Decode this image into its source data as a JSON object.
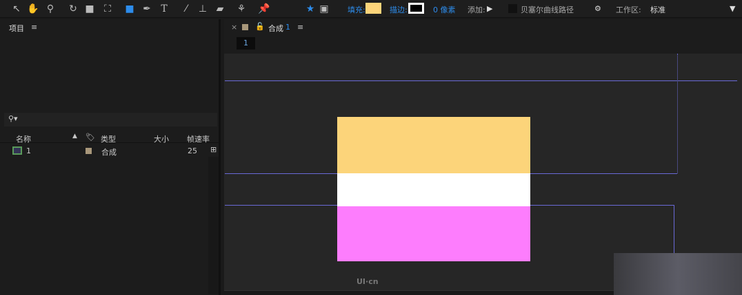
{
  "toolbar": {
    "tools": [
      "selection-tool",
      "hand-tool",
      "zoom-tool",
      "rotate-tool",
      "camera-tool",
      "pan-behind-tool",
      "rectangle-tool",
      "pen-tool",
      "text-tool",
      "brush-tool",
      "clone-stamp-tool",
      "eraser-tool",
      "roto-brush-tool",
      "puppet-pin-tool"
    ],
    "fill_label": "填充:",
    "fill_color": "#fcd47a",
    "stroke_label": "描边:",
    "stroke_width": "0 像素",
    "add_label": "添加:",
    "bezier_label": "贝塞尔曲线路径",
    "workspace_label": "工作区:",
    "workspace_value": "标准"
  },
  "project": {
    "title": "项目",
    "columns": [
      "名称",
      "类型",
      "大小",
      "帧速率"
    ],
    "rows": [
      {
        "name": "1",
        "type": "合成",
        "size": "",
        "fps": "25"
      }
    ]
  },
  "comp": {
    "close": "×",
    "title": "合成",
    "title_num": "1",
    "tab": "1",
    "layers": [
      {
        "color": "#fcd47a"
      },
      {
        "color": "#ffffff"
      },
      {
        "color": "#fd7dfd"
      }
    ]
  },
  "watermark": "UI·cn"
}
